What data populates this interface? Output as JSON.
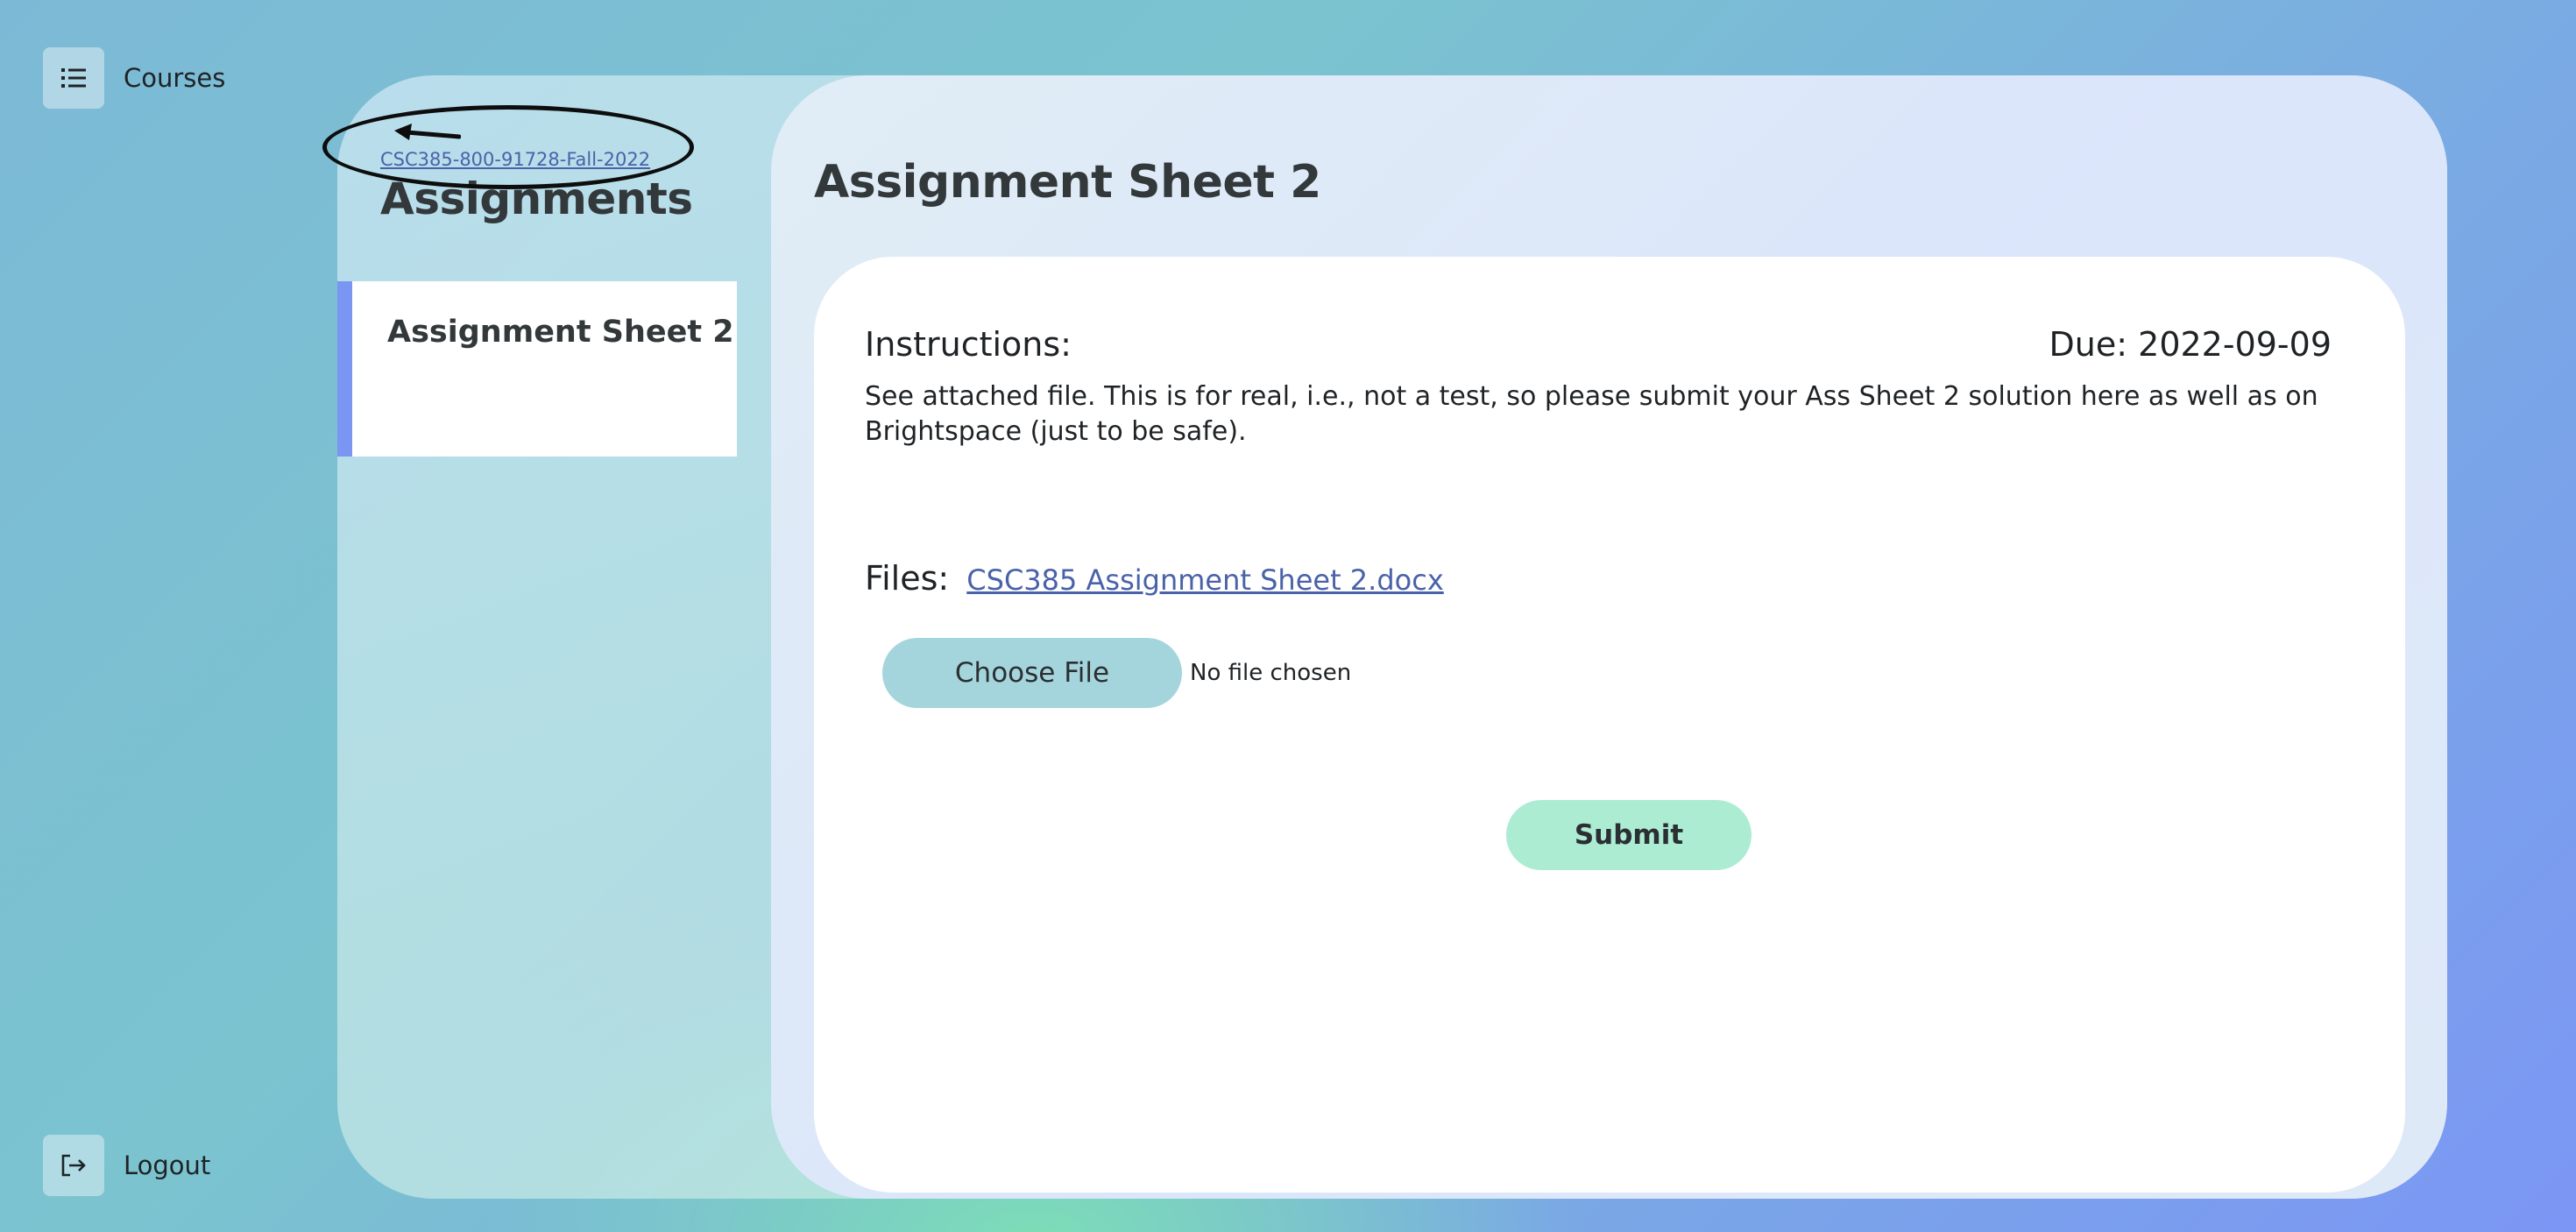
{
  "nav": {
    "courses_label": "Courses",
    "courses_icon": "list-icon",
    "logout_label": "Logout",
    "logout_icon": "logout-icon"
  },
  "sidebar": {
    "breadcrumb": "CSC385-800-91728-Fall-2022",
    "heading": "Assignments",
    "items": [
      {
        "label": "Assignment Sheet 2",
        "active": true
      }
    ],
    "accent_color": "#7b95f2"
  },
  "main": {
    "title": "Assignment Sheet 2",
    "instructions_label": "Instructions:",
    "due": "Due: 2022-09-09",
    "instructions_text": "See attached file. This is for real, i.e., not a test, so please submit your Ass Sheet 2 solution here as well as on Brightspace (just to be safe).",
    "files_label": "Files:",
    "file_name": "CSC385 Assignment Sheet 2.docx",
    "choose_file_label": "Choose File",
    "no_file_text": "No file chosen",
    "submit_label": "Submit"
  },
  "colors": {
    "link": "#4a62a8",
    "choose_file_button": "#a5d5dc",
    "submit_button": "#acecd3"
  }
}
